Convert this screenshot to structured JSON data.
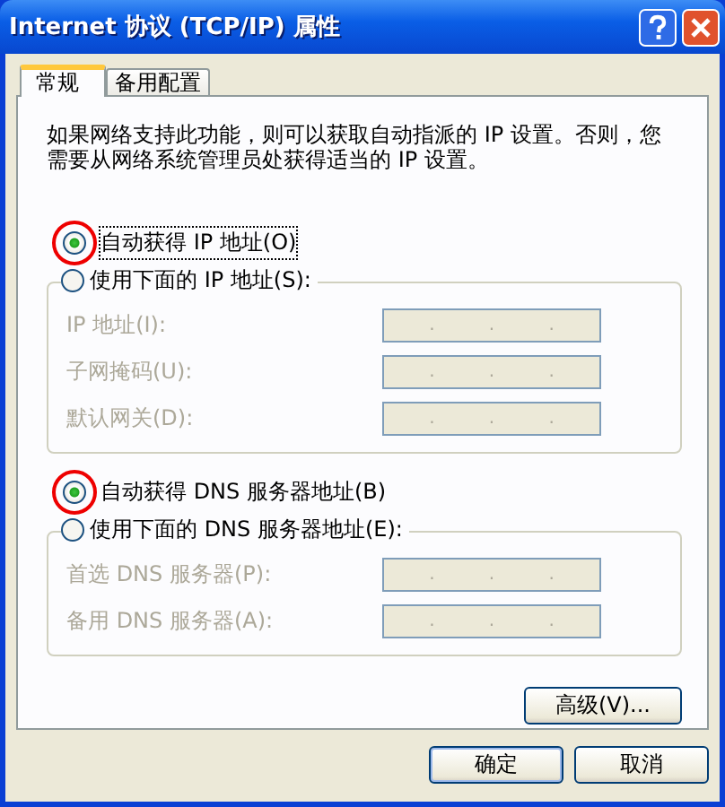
{
  "window": {
    "title": "Internet 协议 (TCP/IP) 属性"
  },
  "tabs": [
    {
      "label": "常规",
      "selected": true
    },
    {
      "label": "备用配置",
      "selected": false
    }
  ],
  "description": "如果网络支持此功能，则可以获取自动指派的 IP 设置。否则，您需要从网络系统管理员处获得适当的 IP 设置。",
  "sections": [
    {
      "auto": {
        "label": "自动获得 IP 地址(O)",
        "selected": true,
        "focused": true,
        "circled": true
      },
      "manual": {
        "label": "使用下面的 IP 地址(S):",
        "selected": false
      },
      "fields": [
        {
          "label": "IP 地址(I):",
          "disabled": true,
          "separators": [
            ".",
            ".",
            "."
          ]
        },
        {
          "label": "子网掩码(U):",
          "disabled": true,
          "separators": [
            ".",
            ".",
            "."
          ]
        },
        {
          "label": "默认网关(D):",
          "disabled": true,
          "separators": [
            ".",
            ".",
            "."
          ]
        }
      ]
    },
    {
      "auto": {
        "label": "自动获得 DNS 服务器地址(B)",
        "selected": true,
        "focused": false,
        "circled": true
      },
      "manual": {
        "label": "使用下面的 DNS 服务器地址(E):",
        "selected": false
      },
      "fields": [
        {
          "label": "首选 DNS 服务器(P):",
          "disabled": true,
          "separators": [
            ".",
            ".",
            "."
          ]
        },
        {
          "label": "备用 DNS 服务器(A):",
          "disabled": true,
          "separators": [
            ".",
            ".",
            "."
          ]
        }
      ]
    }
  ],
  "advanced_button": "高级(V)...",
  "buttons": [
    "确定",
    "取消"
  ]
}
